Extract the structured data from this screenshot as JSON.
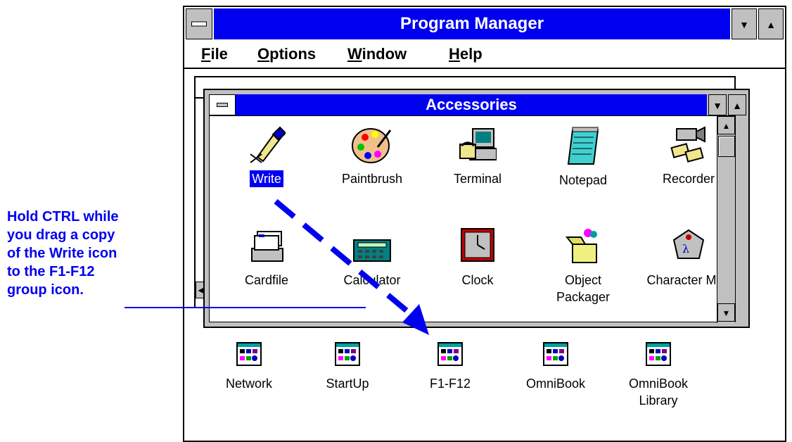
{
  "window": {
    "title": "Program Manager"
  },
  "menu": {
    "file": "File",
    "options": "Options",
    "window": "Window",
    "help": "Help"
  },
  "accessories": {
    "title": "Accessories",
    "icons": [
      {
        "label": "Write",
        "icon": "write-icon"
      },
      {
        "label": "Paintbrush",
        "icon": "paintbrush-icon"
      },
      {
        "label": "Terminal",
        "icon": "terminal-icon"
      },
      {
        "label": "Notepad",
        "icon": "notepad-icon"
      },
      {
        "label": "Recorder",
        "icon": "recorder-icon"
      },
      {
        "label": "Cardfile",
        "icon": "cardfile-icon"
      },
      {
        "label": "Calculator",
        "icon": "calculator-icon"
      },
      {
        "label": "Clock",
        "icon": "clock-icon"
      },
      {
        "label": "Object\nPackager",
        "icon": "object-packager-icon"
      },
      {
        "label": "Character Map",
        "icon": "character-map-icon"
      }
    ]
  },
  "groups": [
    {
      "label": "Network"
    },
    {
      "label": "StartUp"
    },
    {
      "label": "F1-F12"
    },
    {
      "label": "OmniBook"
    },
    {
      "label": "OmniBook\nLibrary"
    }
  ],
  "callout": {
    "line1": "Hold CTRL while",
    "line2": "you drag a copy",
    "line3": "of the Write icon",
    "line4": "to the F1-F12",
    "line5": "group icon."
  },
  "colors": {
    "titlebar": "#0000f0",
    "callout": "#0000f0",
    "face": "#c0c0c0"
  }
}
